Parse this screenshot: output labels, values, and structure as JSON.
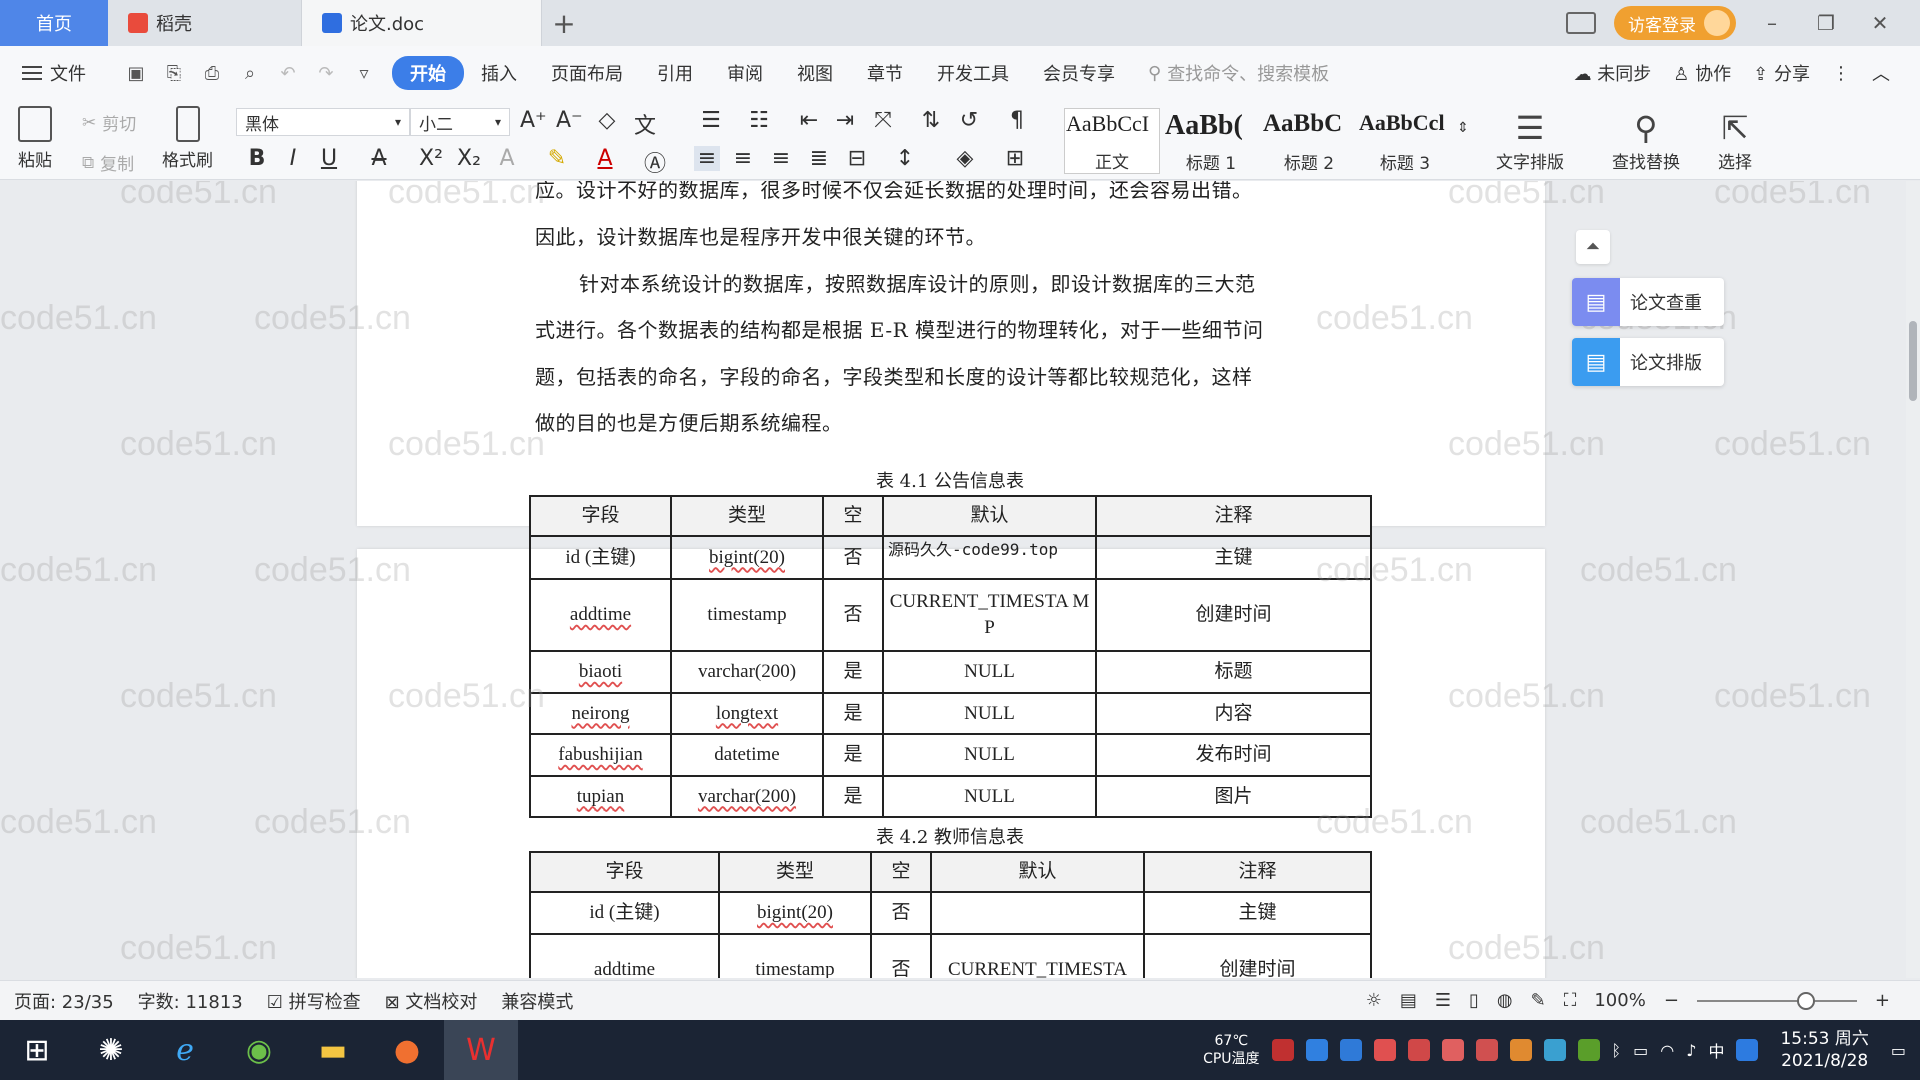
{
  "tabs": {
    "home": "首页",
    "daoke": "稻壳",
    "doc": "论文.doc",
    "add": "+"
  },
  "titlebar": {
    "login": "访客登录"
  },
  "menu": {
    "file": "文件",
    "items": [
      "开始",
      "插入",
      "页面布局",
      "引用",
      "审阅",
      "视图",
      "章节",
      "开发工具",
      "会员专享"
    ],
    "search_placeholder": "查找命令、搜索模板",
    "sync": "未同步",
    "collab": "协作",
    "share": "分享"
  },
  "ribbon": {
    "paste": "粘贴",
    "cut": "剪切",
    "copy": "复制",
    "format_painter": "格式刷",
    "font_name": "黑体",
    "font_size": "小二",
    "styles": [
      {
        "sample": "AaBbCcI",
        "label": "正文"
      },
      {
        "sample": "AaBb(",
        "label": "标题 1"
      },
      {
        "sample": "AaBbC",
        "label": "标题 2"
      },
      {
        "sample": "AaBbCcl",
        "label": "标题 3"
      }
    ],
    "text_layout": "文字排版",
    "find_replace": "查找替换",
    "select": "选择"
  },
  "document": {
    "paragraphs": [
      "应。设计不好的数据库，很多时候不仅会延长数据的处理时间，还会容易出错。",
      "因此，设计数据库也是程序开发中很关键的环节。",
      "针对本系统设计的数据库，按照数据库设计的原则，即设计数据库的三大范",
      "式进行。各个数据表的结构都是根据 E-R 模型进行的物理转化，对于一些细节问",
      "题，包括表的命名，字段的命名，字段类型和长度的设计等都比较规范化，这样",
      "做的目的也是方便后期系统编程。"
    ],
    "table1": {
      "caption": "表 4.1  公告信息表",
      "headers": [
        "字段",
        "类型",
        "空",
        "默认",
        "注释"
      ],
      "rows": [
        [
          "id (主键)",
          "bigint(20)",
          "否",
          "源码久久-code99.top",
          "主键"
        ],
        [
          "addtime",
          "timestamp",
          "否",
          "CURRENT_TIMESTA MP",
          "创建时间"
        ],
        [
          "biaoti",
          "varchar(200)",
          "是",
          "NULL",
          "标题"
        ],
        [
          "neirong",
          "longtext",
          "是",
          "NULL",
          "内容"
        ],
        [
          "fabushijian",
          "datetime",
          "是",
          "NULL",
          "发布时间"
        ],
        [
          "tupian",
          "varchar(200)",
          "是",
          "NULL",
          "图片"
        ]
      ]
    },
    "table2": {
      "caption": "表 4.2  教师信息表",
      "headers": [
        "字段",
        "类型",
        "空",
        "默认",
        "注释"
      ],
      "rows": [
        [
          "id (主键)",
          "bigint(20)",
          "否",
          "",
          "主键"
        ],
        [
          "addtime",
          "timestamp",
          "否",
          "CURRENT_TIMESTA",
          "创建时间"
        ]
      ]
    },
    "watermark": "code51.cn"
  },
  "side_panel": {
    "check": "论文查重",
    "format": "论文排版"
  },
  "statusbar": {
    "page": "页面: 23/35",
    "words": "字数: 11813",
    "spellcheck": "拼写检查",
    "proofread": "文档校对",
    "compat": "兼容模式",
    "zoom": "100%"
  },
  "taskbar": {
    "cpu_temp": "67℃",
    "cpu_label": "CPU温度",
    "ime": "中",
    "time": "15:53 周六",
    "date": "2021/8/28"
  }
}
